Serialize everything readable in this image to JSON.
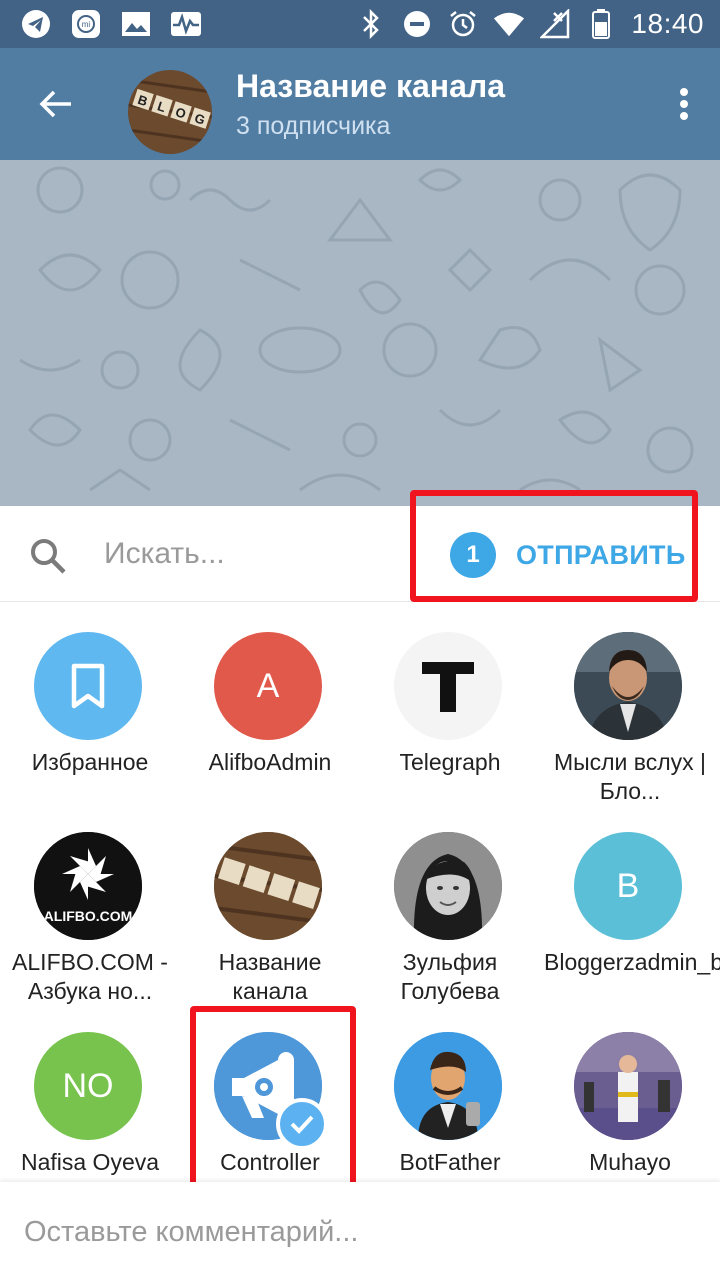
{
  "status_bar": {
    "time": "18:40",
    "left_icons": [
      "telegram-icon",
      "mi-icon",
      "image-icon",
      "pulse-icon"
    ],
    "right_icons": [
      "bluetooth-icon",
      "dnd-icon",
      "alarm-icon",
      "wifi-icon",
      "signal-icon",
      "battery-icon"
    ]
  },
  "header": {
    "title": "Название канала",
    "subtitle": "3 подписчика",
    "avatar_text": "BLOG"
  },
  "share": {
    "search_placeholder": "Искать...",
    "selected_count": "1",
    "send_label": "ОТПРАВИТЬ",
    "comment_placeholder": "Оставьте комментарий..."
  },
  "contacts": [
    {
      "name": "Избранное",
      "avatar": "bookmark",
      "color": "#5fb8ef"
    },
    {
      "name": "AlifboAdmin",
      "avatar": "A",
      "color": "#e0594a"
    },
    {
      "name": "Telegraph",
      "avatar": "T",
      "color": "#f4f4f4"
    },
    {
      "name": "Мысли вслух | Бло...",
      "avatar": "photo-man",
      "color": "#4a5a66"
    },
    {
      "name": "ALIFBO.COM - Азбука но...",
      "avatar": "ALIFBO.COM",
      "color": "#111111"
    },
    {
      "name": "Название канала",
      "avatar": "BLOG",
      "color": "#7a5634"
    },
    {
      "name": "Зульфия Голубева",
      "avatar": "photo-woman",
      "color": "#555555"
    },
    {
      "name": "Bloggerzadmin_bot",
      "avatar": "B",
      "color": "#5abfd7"
    },
    {
      "name": "Nafisa Oyeva",
      "avatar": "NO",
      "color": "#77c34d"
    },
    {
      "name": "Controller",
      "avatar": "megaphone",
      "color": "#4e97d8",
      "selected": true
    },
    {
      "name": "BotFather",
      "avatar": "botfather",
      "color": "#3d9be3"
    },
    {
      "name": "Muhayo",
      "avatar": "photo-karate",
      "color": "#7a6aa8"
    }
  ],
  "colors": {
    "header": "#527da3",
    "status_bar": "#426385",
    "accent": "#3ea7e6",
    "highlight_box": "#f0141e"
  }
}
